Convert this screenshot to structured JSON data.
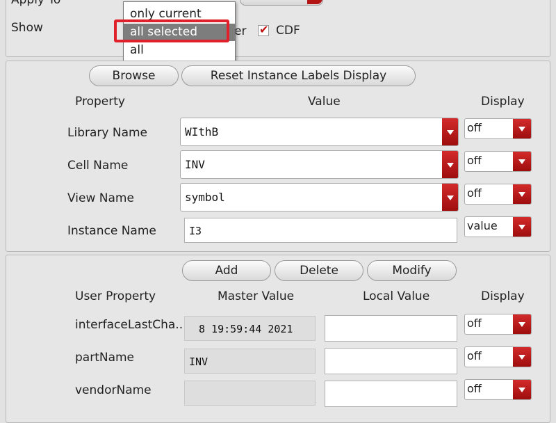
{
  "top": {
    "apply_to_label": "Apply To",
    "show_label": "Show",
    "show_partial_text": "er",
    "cdf_label": "CDF",
    "cdf_checked": true
  },
  "apply_to_dropdown": {
    "options": [
      "only current",
      "all selected",
      "all"
    ],
    "highlighted": "all selected"
  },
  "instance_panel": {
    "browse_label": "Browse",
    "reset_label": "Reset Instance Labels Display",
    "headers": {
      "property": "Property",
      "value": "Value",
      "display": "Display"
    },
    "rows": [
      {
        "label": "Library Name",
        "value": "WIthB",
        "display": "off"
      },
      {
        "label": "Cell Name",
        "value": "INV",
        "display": "off"
      },
      {
        "label": "View Name",
        "value": "symbol",
        "display": "off"
      },
      {
        "label": "Instance Name",
        "value": "I3",
        "display": "value"
      }
    ]
  },
  "user_panel": {
    "add_label": "Add",
    "delete_label": "Delete",
    "modify_label": "Modify",
    "headers": {
      "user_property": "User Property",
      "master_value": "Master Value",
      "local_value": "Local Value",
      "display": "Display"
    },
    "rows": [
      {
        "label": "interfaceLastCha..",
        "master": "8 19:59:44 2021",
        "local": "",
        "display": "off"
      },
      {
        "label": "partName",
        "master": "INV",
        "local": "",
        "display": "off"
      },
      {
        "label": "vendorName",
        "master": "",
        "local": "",
        "display": "off"
      }
    ]
  },
  "colors": {
    "accent_red": "#b51414",
    "highlight_gray": "#7d7d7d",
    "focus_red": "#e0202a"
  }
}
